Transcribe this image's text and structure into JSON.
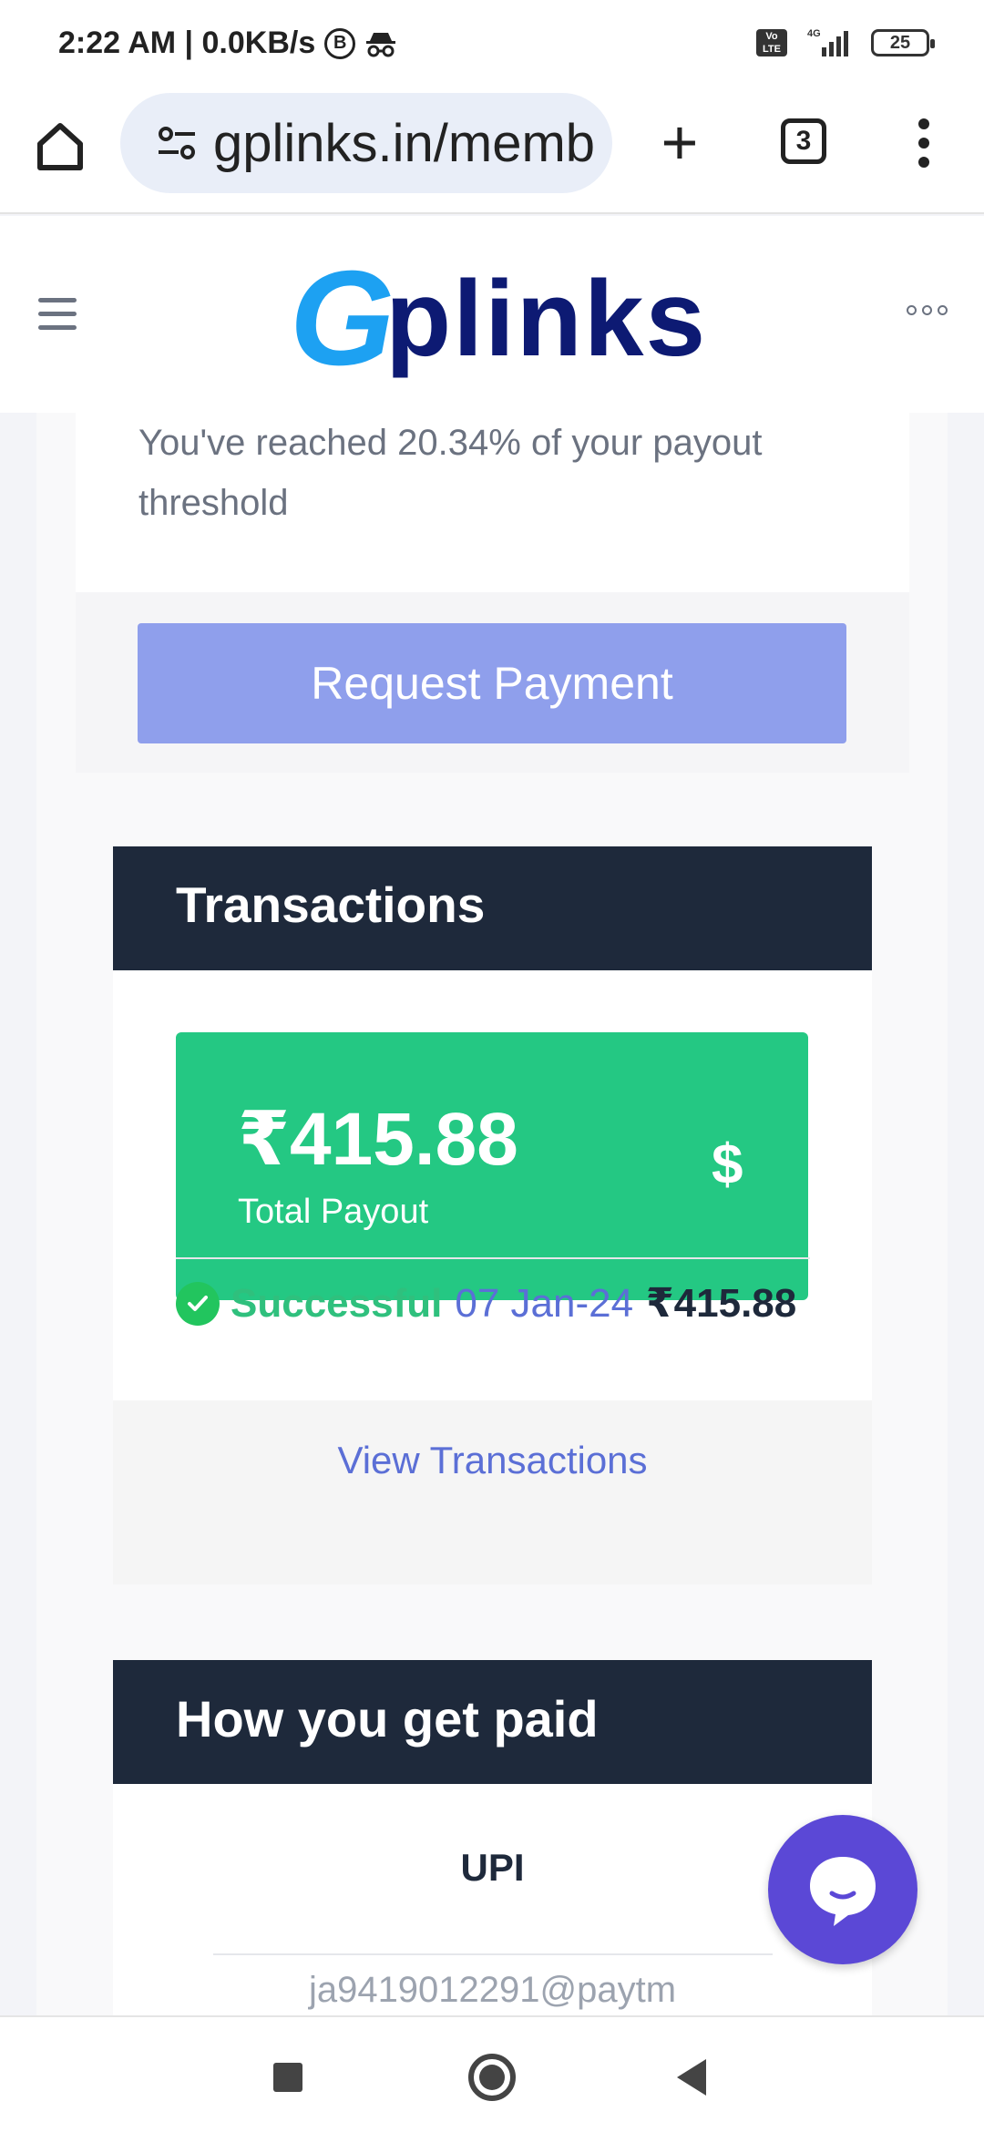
{
  "status_bar": {
    "time_speed": "2:22 AM | 0.0KB/s",
    "b_badge": "B",
    "incognito_icon": "incognito-icon",
    "volte": "Vo LTE",
    "network": "4G",
    "battery": "25"
  },
  "browser": {
    "url": "gplinks.in/memb",
    "tab_count": "3",
    "new_tab_label": "+"
  },
  "site": {
    "logo_g": "G",
    "logo_rest": "plinks"
  },
  "payout": {
    "threshold_text": "You've reached 20.34% of your payout threshold",
    "request_button": "Request Payment"
  },
  "transactions": {
    "title": "Transactions",
    "total_amount": "₹415.88",
    "total_label": "Total Payout",
    "currency_symbol": "$",
    "row": {
      "status": "Successful",
      "date": "07 Jan-24",
      "amount": "₹415.88"
    },
    "view_link": "View Transactions"
  },
  "get_paid": {
    "title": "How you get paid",
    "method": "UPI",
    "upi_id": "ja9419012291@paytm"
  },
  "colors": {
    "accent_green": "#24c883",
    "dark_header": "#1e293b",
    "button_purple": "#8f9fec",
    "chat_purple": "#5b48d6"
  }
}
